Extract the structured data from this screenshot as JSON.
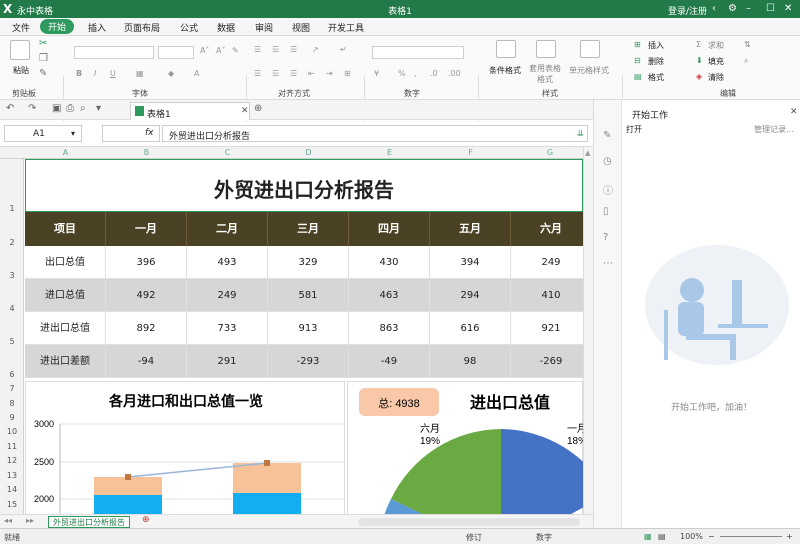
{
  "titlebar": {
    "logo": "X",
    "app_name": "永中表格",
    "doc_title": "表格1",
    "login": "登录/注册"
  },
  "menu": [
    "文件",
    "开始",
    "插入",
    "页面布局",
    "公式",
    "数据",
    "审阅",
    "视图",
    "开发工具"
  ],
  "ribbon": {
    "paste": "粘贴",
    "group_clipboard": "剪贴板",
    "group_font": "字体",
    "group_align": "对齐方式",
    "group_number": "数字",
    "group_style": "样式",
    "group_edit": "编辑",
    "cond_format": "条件格式",
    "table_format": "套用表格格式",
    "cell_format": "单元格样式",
    "insert": "插入",
    "delete": "删除",
    "format": "格式",
    "sum": "求和",
    "fill": "填充",
    "clear": "清除",
    "bold": "B",
    "italic": "I",
    "underline": "U",
    "currency": "¥",
    "percent": "%"
  },
  "tab": {
    "label": "表格1"
  },
  "formula_bar": {
    "cell_ref": "A1",
    "fx": "fx",
    "content": "外贸进出口分析报告"
  },
  "columns": [
    "A",
    "B",
    "C",
    "D",
    "E",
    "F",
    "G"
  ],
  "rows": [
    "1",
    "2",
    "3",
    "4",
    "5",
    "6",
    "7",
    "8",
    "9",
    "10",
    "11",
    "12",
    "13",
    "14",
    "15"
  ],
  "sheet": {
    "title": "外贸进出口分析报告",
    "headers": [
      "项目",
      "一月",
      "二月",
      "三月",
      "四月",
      "五月",
      "六月"
    ],
    "data": [
      [
        "出口总值",
        "396",
        "493",
        "329",
        "430",
        "394",
        "249"
      ],
      [
        "进口总值",
        "492",
        "249",
        "581",
        "463",
        "294",
        "410"
      ],
      [
        "进出口总值",
        "892",
        "733",
        "913",
        "863",
        "616",
        "921"
      ],
      [
        "进出口差额",
        "-94",
        "291",
        "-293",
        "-49",
        "98",
        "-269"
      ]
    ]
  },
  "chart_data": [
    {
      "type": "bar",
      "title": "各月进口和出口总值一览",
      "xlabel": "",
      "ylabel": "",
      "ylim": [
        1800,
        3000
      ],
      "yticks": [
        "3000",
        "2500",
        "2000"
      ],
      "categories": [
        "",
        ""
      ],
      "series": [
        {
          "values": [
            2300,
            2550
          ]
        }
      ]
    },
    {
      "type": "pie",
      "title": "进出口总值",
      "badge": "总: 4938",
      "labels": [
        "六月",
        "一月"
      ],
      "percents": [
        "19%",
        "18%"
      ]
    }
  ],
  "sheet_tab": "外贸进出口分析报告",
  "status": {
    "ready": "就绪",
    "revise": "修订",
    "number": "数字",
    "zoom": "100%"
  },
  "task_pane": {
    "title": "开始工作",
    "open": "打开",
    "manage": "管理记录...",
    "message": "开始工作吧，加油！"
  },
  "colors": {
    "accent": "#217a48",
    "header_bg": "#4b4225",
    "bar_peach": "#f8c298",
    "bar_blue": "#12aef0",
    "pie_green": "#6ba942",
    "pie_blue": "#4472c4"
  }
}
